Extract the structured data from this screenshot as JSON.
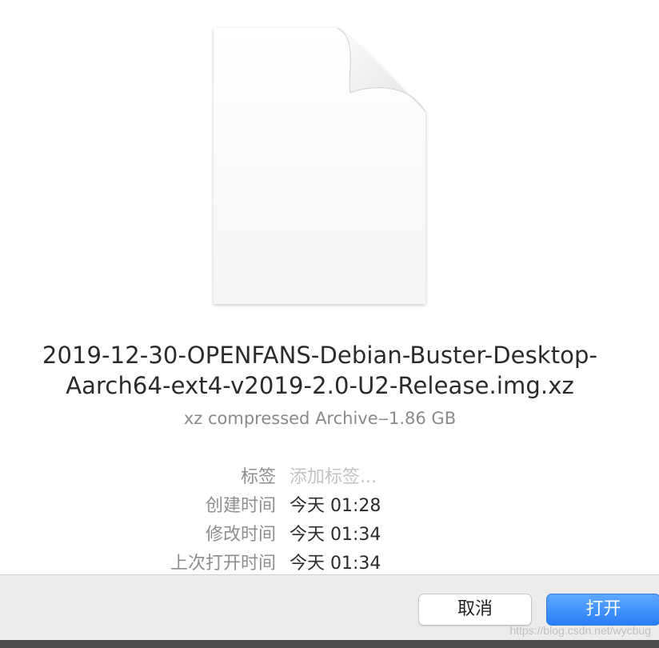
{
  "file": {
    "name_line1": "2019-12-30-OPENFANS-Debian-Buster-Desktop-",
    "name_line2": "Aarch64-ext4-v2019-2.0-U2-Release.img.xz",
    "kind_size": "xz compressed Archive‒1.86 GB",
    "icon": "document-icon"
  },
  "metadata": [
    {
      "label": "标签",
      "value": "添加标签..."
    },
    {
      "label": "创建时间",
      "value": "今天 01:28"
    },
    {
      "label": "修改时间",
      "value": "今天 01:34"
    },
    {
      "label": "上次打开时间",
      "value": "今天 01:34"
    }
  ],
  "buttons": {
    "cancel": "取消",
    "open": "打开"
  },
  "watermark": "https://blog.csdn.net/wycbug",
  "colors": {
    "accent": "#2a7df7",
    "toolbar_bg": "#ececec"
  }
}
